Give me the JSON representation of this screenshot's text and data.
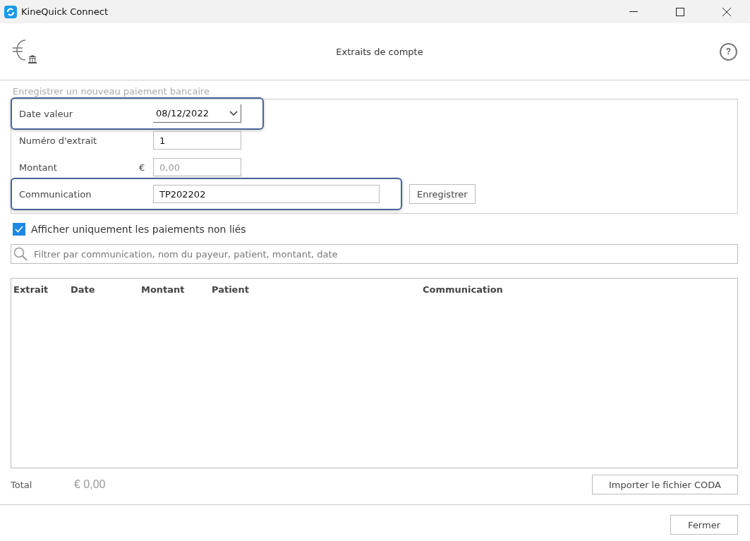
{
  "window": {
    "title": "KineQuick Connect"
  },
  "header": {
    "title": "Extraits de compte",
    "help": "?"
  },
  "form": {
    "title": "Enregistrer un nouveau paiement bancaire",
    "fields": [
      {
        "kind": "date",
        "label": "Date valeur",
        "value": "08/12/2022",
        "highlighted": true
      },
      {
        "kind": "text",
        "label": "Numéro d'extrait",
        "value": "1",
        "highlighted": false
      },
      {
        "kind": "amount",
        "label": "Montant",
        "prefix": "€",
        "placeholder": "0,00",
        "highlighted": false
      },
      {
        "kind": "wide",
        "label": "Communication",
        "value": "TP202202",
        "highlighted": true,
        "button": "Enregistrer"
      }
    ]
  },
  "filter": {
    "label": "Afficher uniquement les paiements non liés",
    "checked": true
  },
  "search": {
    "placeholder": "Filtrer par communication, nom du payeur, patient, montant, date"
  },
  "table": {
    "columns": [
      "Extrait",
      "Date",
      "Montant",
      "Patient",
      "Communication"
    ]
  },
  "footer": {
    "total_label": "Total",
    "total_value": "€ 0,00",
    "import_button": "Importer le fichier CODA",
    "close_button": "Fermer"
  }
}
